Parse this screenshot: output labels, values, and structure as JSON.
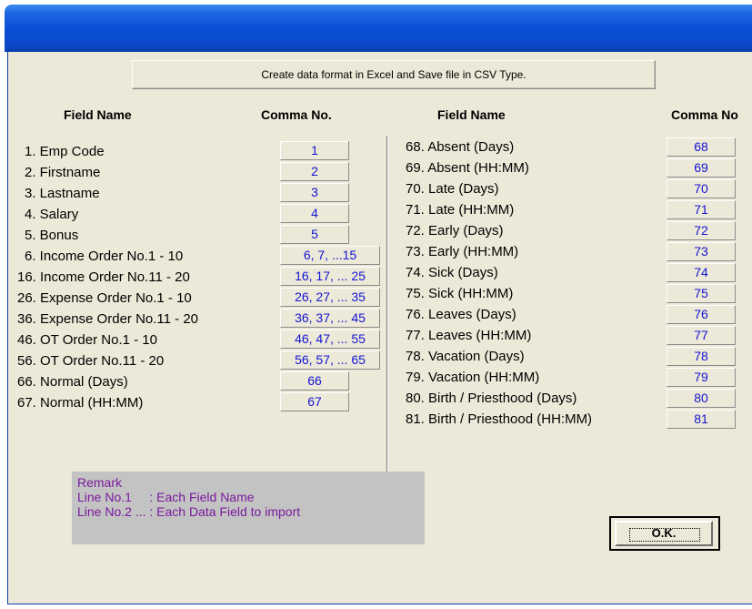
{
  "window": {
    "title": ""
  },
  "banner": "Create data format in Excel and Save file in CSV Type.",
  "headers": {
    "field_name": "Field Name",
    "comma_no": "Comma No.",
    "comma_no_right": "Comma No"
  },
  "left_fields": [
    {
      "label": "1. Emp Code",
      "comma": "1"
    },
    {
      "label": "2. Firstname",
      "comma": "2"
    },
    {
      "label": "3. Lastname",
      "comma": "3"
    },
    {
      "label": "4. Salary",
      "comma": "4"
    },
    {
      "label": "5. Bonus",
      "comma": "5"
    },
    {
      "label": "6. Income Order No.1 - 10",
      "comma": "6, 7, ...15"
    },
    {
      "label": "16. Income Order No.11 - 20",
      "comma": "16, 17, ... 25"
    },
    {
      "label": "26. Expense Order No.1 - 10",
      "comma": "26, 27, ... 35"
    },
    {
      "label": "36. Expense Order No.11 - 20",
      "comma": "36, 37, ... 45"
    },
    {
      "label": "46. OT Order No.1 - 10",
      "comma": "46, 47, ... 55"
    },
    {
      "label": "56. OT Order No.11 - 20",
      "comma": "56, 57, ... 65"
    },
    {
      "label": "66. Normal (Days)",
      "comma": "66"
    },
    {
      "label": "67. Normal (HH:MM)",
      "comma": "67"
    }
  ],
  "right_fields": [
    {
      "label": "68. Absent (Days)",
      "comma": "68"
    },
    {
      "label": "69. Absent (HH:MM)",
      "comma": "69"
    },
    {
      "label": "70. Late (Days)",
      "comma": "70"
    },
    {
      "label": "71. Late (HH:MM)",
      "comma": "71"
    },
    {
      "label": "72. Early (Days)",
      "comma": "72"
    },
    {
      "label": "73. Early (HH:MM)",
      "comma": "73"
    },
    {
      "label": "74. Sick (Days)",
      "comma": "74"
    },
    {
      "label": "75. Sick (HH:MM)",
      "comma": "75"
    },
    {
      "label": "76. Leaves (Days)",
      "comma": "76"
    },
    {
      "label": "77. Leaves (HH:MM)",
      "comma": "77"
    },
    {
      "label": "78. Vacation (Days)",
      "comma": "78"
    },
    {
      "label": "79. Vacation (HH:MM)",
      "comma": "79"
    },
    {
      "label": "80. Birth / Priesthood (Days)",
      "comma": "80"
    },
    {
      "label": "81. Birth / Priesthood (HH:MM)",
      "comma": "81"
    }
  ],
  "remark": {
    "title": "Remark",
    "line1": "Line No.1     : Each Field Name",
    "line2": "Line No.2 ... : Each Data Field to import"
  },
  "ok_button": "O.K.",
  "colors": {
    "client_bg": "#ece9d8",
    "titlebar": "#0a4fd6",
    "comma_text": "#1414d2",
    "remark_text": "#7a1a9e",
    "remark_bg": "#c3c3c3"
  }
}
